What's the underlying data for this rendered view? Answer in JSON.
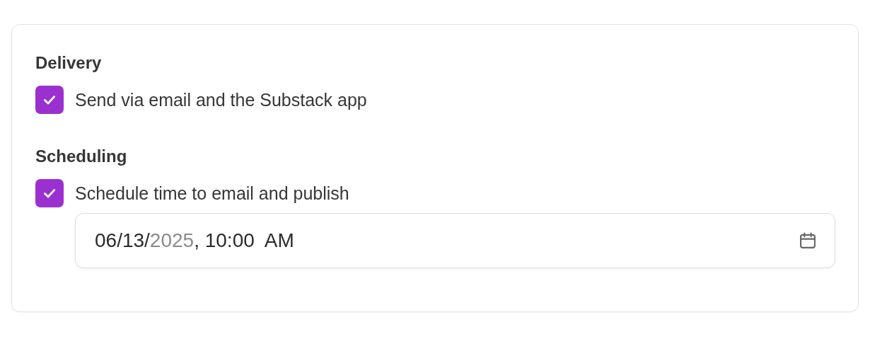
{
  "sections": [
    {
      "heading": "Delivery",
      "checkbox": {
        "label": "Send via email and the Substack app",
        "checked": true
      }
    },
    {
      "heading": "Scheduling",
      "checkbox": {
        "label": "Schedule time to email and publish",
        "checked": true
      },
      "datetime_field": {
        "segments": [
          {
            "text": "06/13/",
            "dimmed": false
          },
          {
            "text": "2025",
            "dimmed": true
          },
          {
            "text": ", 10:00  AM",
            "dimmed": false
          }
        ]
      }
    }
  ]
}
